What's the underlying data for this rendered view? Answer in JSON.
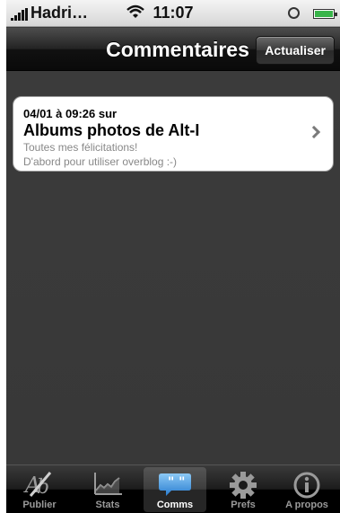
{
  "statusbar": {
    "carrier": "Hadri…",
    "time": "11:07"
  },
  "navbar": {
    "title": "Commentaires",
    "refresh_label": "Actualiser"
  },
  "comments": [
    {
      "date": "04/01 à 09:26 sur",
      "title": "Albums photos de Alt-I",
      "line1": "Toutes mes félicitations!",
      "line2": "D'abord pour utiliser overblog :-)"
    }
  ],
  "tabbar": {
    "tabs": [
      {
        "label": "Publier",
        "icon": "pen-icon"
      },
      {
        "label": "Stats",
        "icon": "chart-icon"
      },
      {
        "label": "Comms",
        "icon": "speech-bubble-icon",
        "selected": true
      },
      {
        "label": "Prefs",
        "icon": "gear-icon"
      },
      {
        "label": "A propos",
        "icon": "info-icon"
      }
    ]
  },
  "colors": {
    "accent_blue": "#4a9fe0",
    "battery_green": "#39b54a",
    "background": "#3a3a3a"
  }
}
